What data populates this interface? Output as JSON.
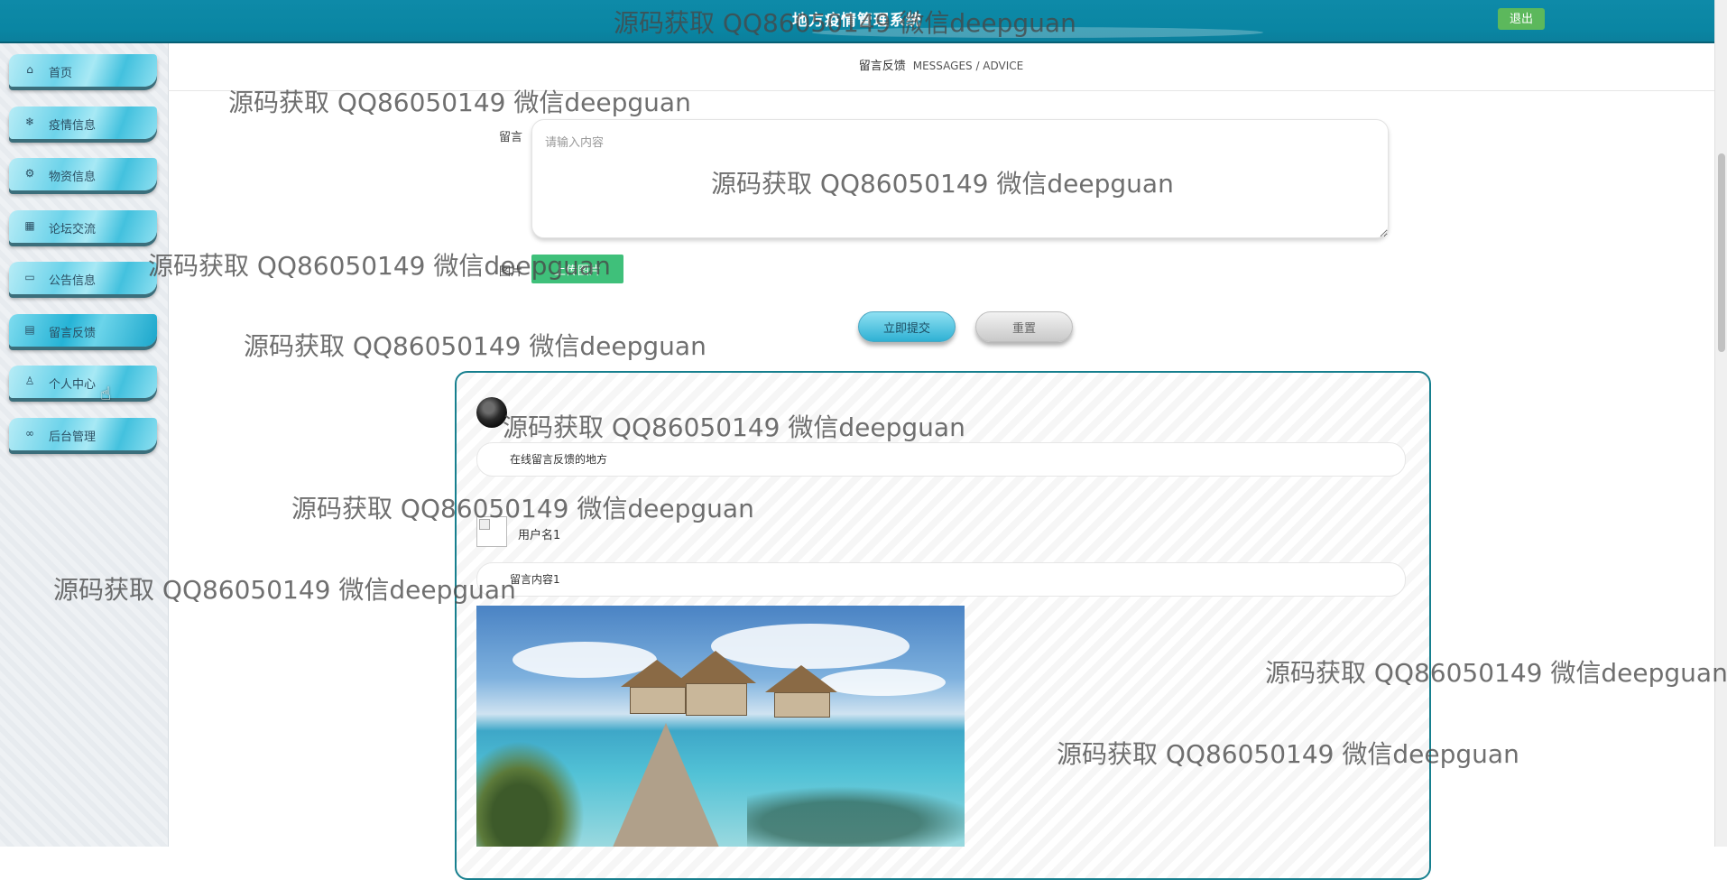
{
  "header": {
    "title": "地方疫情管理系统",
    "logout_label": "退出"
  },
  "sidebar": {
    "items": [
      {
        "label": "首页",
        "icon": "home-icon",
        "glyph": "⌂"
      },
      {
        "label": "疫情信息",
        "icon": "snowflake-icon",
        "glyph": "❄"
      },
      {
        "label": "物资信息",
        "icon": "gear-icon",
        "glyph": "⚙"
      },
      {
        "label": "论坛交流",
        "icon": "chart-icon",
        "glyph": "▦"
      },
      {
        "label": "公告信息",
        "icon": "book-icon",
        "glyph": "▭"
      },
      {
        "label": "留言反馈",
        "icon": "calendar-icon",
        "glyph": "▤",
        "active": true
      },
      {
        "label": "个人中心",
        "icon": "user-icon",
        "glyph": "♙"
      },
      {
        "label": "后台管理",
        "icon": "link-icon",
        "glyph": "∞"
      }
    ]
  },
  "breadcrumb": {
    "cn": "留言反馈",
    "en": "MESSAGES / ADVICE"
  },
  "form": {
    "message_label": "留言",
    "message_placeholder": "请输入内容",
    "message_value": "",
    "image_label": "图片",
    "upload_label": "上传图片",
    "submit_label": "立即提交",
    "reset_label": "重置"
  },
  "messages": {
    "intro": "在线留言反馈的地方",
    "username": "用户名1",
    "content": "留言内容1"
  },
  "watermark": "源码获取 QQ86050149 微信deepguan",
  "colors": {
    "topbar": "#0a86a3",
    "accent": "#2fb1d4",
    "upload_green": "#3fc07a",
    "logout_green": "#5cb85c",
    "card_border": "#167f8e"
  }
}
